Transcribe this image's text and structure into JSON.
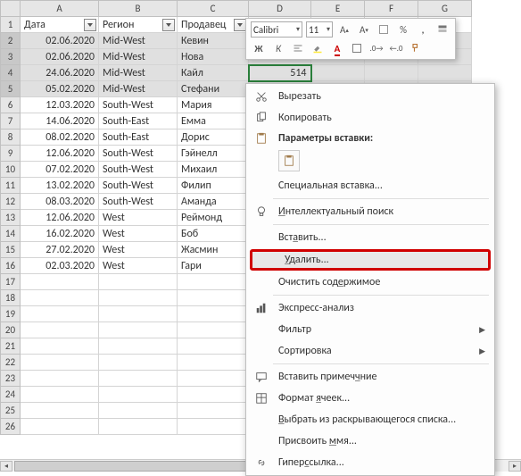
{
  "columns": [
    "A",
    "B",
    "C",
    "D",
    "E",
    "F",
    "G"
  ],
  "headers": {
    "A": "Дата",
    "B": "Регион",
    "C": "Продавец"
  },
  "rows": [
    {
      "n": 1,
      "hdr": true
    },
    {
      "n": 2,
      "A": "02.06.2020",
      "B": "Mid-West",
      "C": "Кевин",
      "sel": true
    },
    {
      "n": 3,
      "A": "02.06.2020",
      "B": "Mid-West",
      "C": "Нова",
      "sel": true
    },
    {
      "n": 4,
      "A": "24.06.2020",
      "B": "Mid-West",
      "C": "Кайл",
      "sel": true,
      "D": "514"
    },
    {
      "n": 5,
      "A": "05.02.2020",
      "B": "Mid-West",
      "C": "Стефани",
      "sel": true
    },
    {
      "n": 6,
      "A": "12.03.2020",
      "B": "South-West",
      "C": "Мария"
    },
    {
      "n": 7,
      "A": "14.06.2020",
      "B": "South-East",
      "C": "Емма"
    },
    {
      "n": 8,
      "A": "08.02.2020",
      "B": "South-East",
      "C": "Дорис"
    },
    {
      "n": 9,
      "A": "12.06.2020",
      "B": "South-West",
      "C": "Гэйнелл"
    },
    {
      "n": 10,
      "A": "07.02.2020",
      "B": "South-West",
      "C": "Михаил"
    },
    {
      "n": 11,
      "A": "13.02.2020",
      "B": "South-West",
      "C": "Филип"
    },
    {
      "n": 12,
      "A": "08.03.2020",
      "B": "South-West",
      "C": "Аманда"
    },
    {
      "n": 13,
      "A": "12.06.2020",
      "B": "West",
      "C": "Реймонд"
    },
    {
      "n": 14,
      "A": "16.02.2020",
      "B": "West",
      "C": "Боб"
    },
    {
      "n": 15,
      "A": "27.02.2020",
      "B": "West",
      "C": "Жасмин"
    },
    {
      "n": 16,
      "A": "02.03.2020",
      "B": "West",
      "C": "Гари"
    },
    {
      "n": 17
    },
    {
      "n": 18
    },
    {
      "n": 19
    },
    {
      "n": 20
    },
    {
      "n": 21
    },
    {
      "n": 22
    },
    {
      "n": 23
    },
    {
      "n": 24
    },
    {
      "n": 25
    },
    {
      "n": 26
    }
  ],
  "mini": {
    "font": "Calibri",
    "size": "11"
  },
  "ctx": {
    "cut": "Вырезать",
    "copy": "Копировать",
    "paste_header": "Параметры вставки:",
    "paste_special": "Специальная вставка...",
    "smart_lookup": "Интеллектуальный поиск",
    "insert": "Вставить...",
    "delete": "Удалить...",
    "clear": "Очистить содержимое",
    "quick_analysis": "Экспресс-анализ",
    "filter": "Фильтр",
    "sort": "Сортировка",
    "comment": "Вставить примечание",
    "format_cells": "Формат ячеек...",
    "pick_list": "Выбрать из раскрывающегося списка...",
    "define_name": "Присвоить имя...",
    "hyperlink": "Гиперссылка..."
  }
}
